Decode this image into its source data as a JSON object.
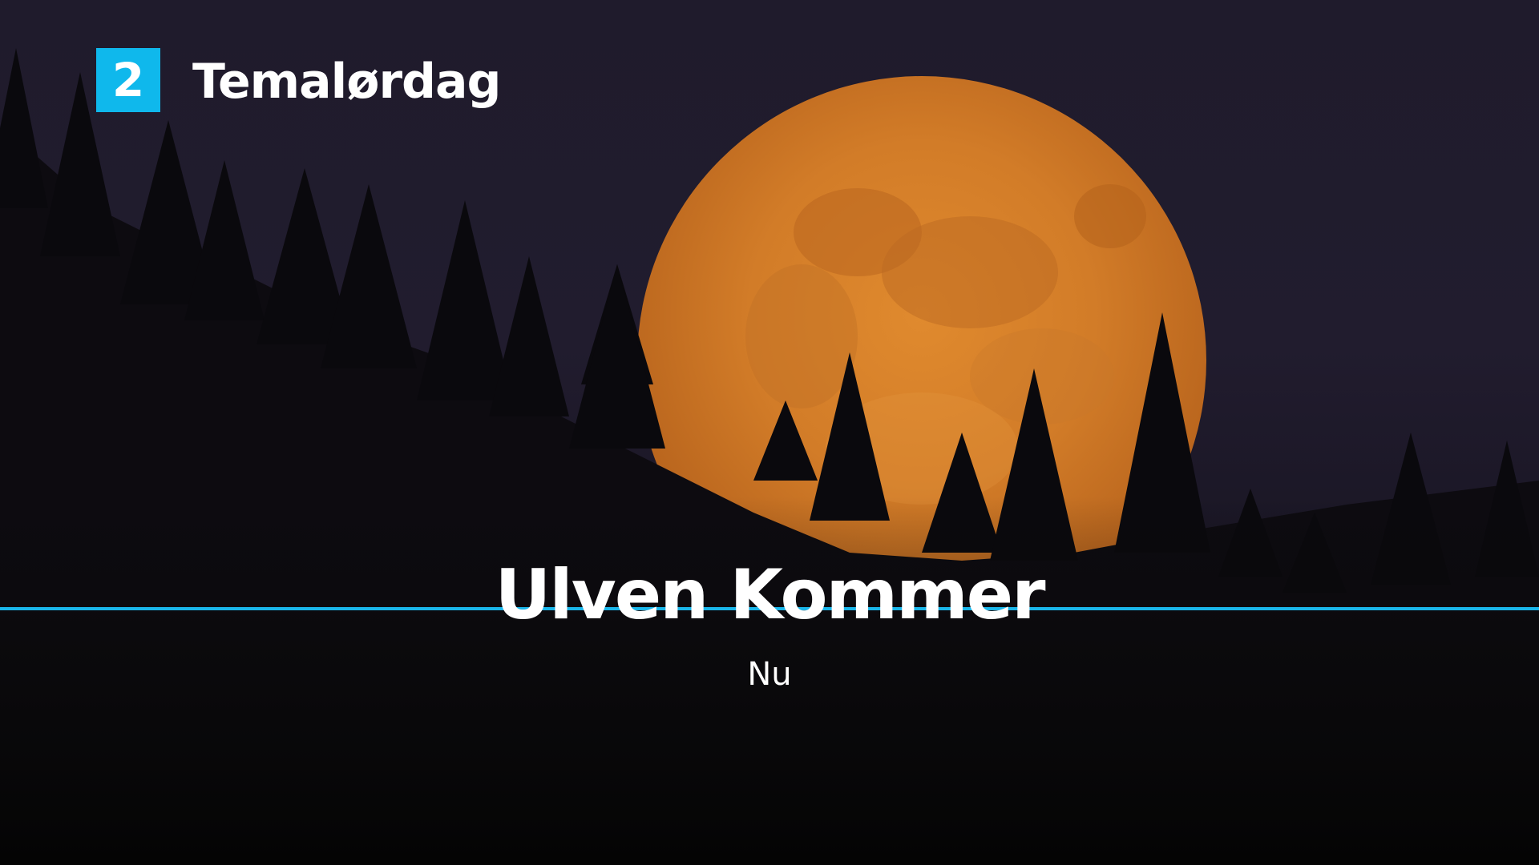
{
  "channel": {
    "logo_number": "2",
    "logo_color": "#0fb8ec",
    "name": "Temalørdag"
  },
  "program": {
    "title": "Ulven Kommer",
    "status": "Nu"
  },
  "background": {
    "subject": "full-moon-over-forest",
    "moon_color": "#d9822b",
    "sky_color": "#211c2e",
    "accent_line_color": "#1ab6ea"
  }
}
